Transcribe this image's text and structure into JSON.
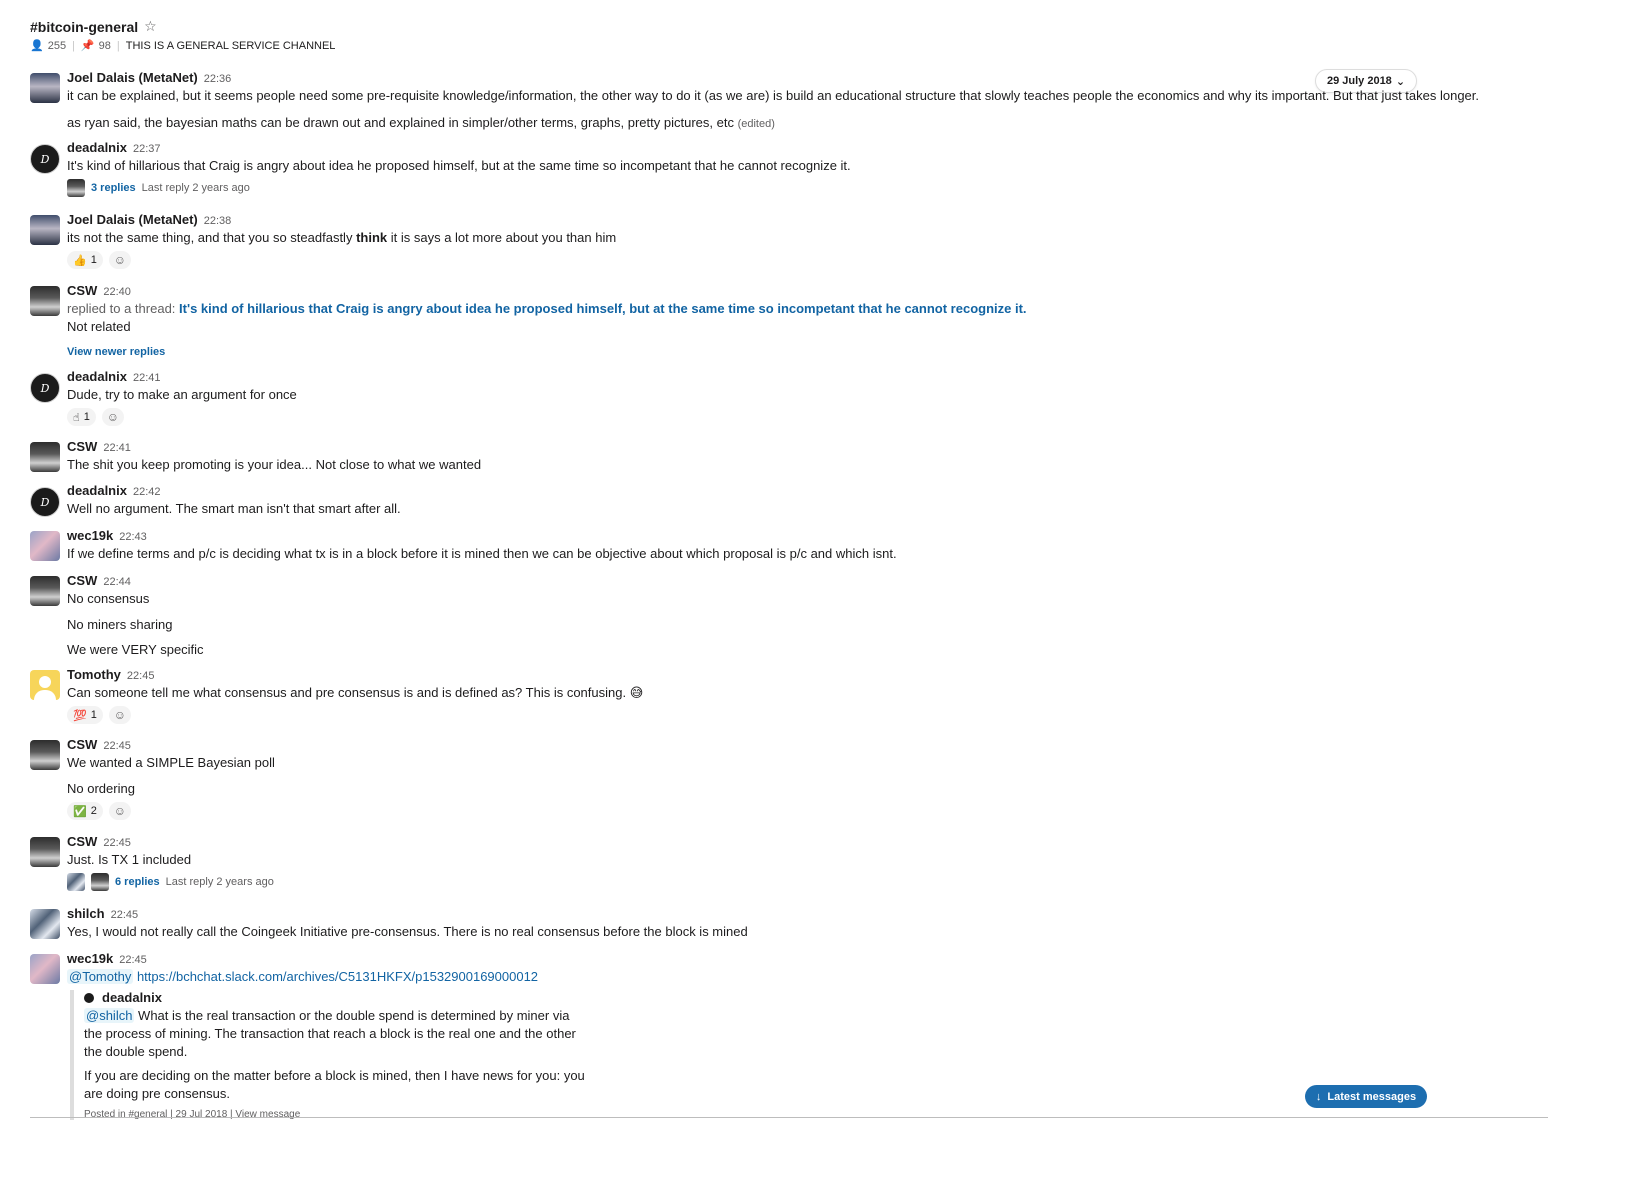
{
  "channel": {
    "name": "#bitcoin-general",
    "members": "255",
    "pins": "98",
    "description": "THIS IS A GENERAL SERVICE CHANNEL"
  },
  "date_pill": "29 July 2018",
  "messages": [
    {
      "name": "Joel Dalais (MetaNet)",
      "time": "22:36",
      "lines": [
        "it can be explained, but it seems people need some pre-requisite knowledge/information, the other way to do it (as we are) is build an educational structure that slowly teaches people the economics and why its important. But that just takes longer.",
        "as ryan said, the bayesian maths can be drawn out and explained in simpler/other terms, graphs, pretty pictures, etc"
      ],
      "edited": "(edited)"
    },
    {
      "name": "deadalnix",
      "time": "22:37",
      "text": "It's kind of hillarious that Craig is angry about idea he proposed himself, but at the same time so incompetant that he cannot recognize it.",
      "thread": {
        "replies": "3 replies",
        "last": "Last reply 2 years ago"
      }
    },
    {
      "name": "Joel Dalais (MetaNet)",
      "time": "22:38",
      "text_a": "its not the same thing, and that you so steadfastly ",
      "text_b": "think",
      "text_c": " it is says a lot more about you than him",
      "reaction": {
        "emoji": "👍",
        "count": "1"
      }
    },
    {
      "name": "CSW",
      "time": "22:40",
      "replied_label": "replied to a thread: ",
      "replied_text": "It's kind of hillarious that Craig is angry about idea he proposed himself, but at the same time so incompetant that he cannot recognize it.",
      "text": "Not related",
      "view_newer": "View newer replies"
    },
    {
      "name": "deadalnix",
      "time": "22:41",
      "text": "Dude, try to make an argument for once",
      "reaction": {
        "emoji": "☝",
        "count": "1"
      }
    },
    {
      "name": "CSW",
      "time": "22:41",
      "text": "The shit you keep promoting is your idea... Not close to what we wanted"
    },
    {
      "name": "deadalnix",
      "time": "22:42",
      "text": "Well no argument. The smart man isn't that smart after all."
    },
    {
      "name": "wec19k",
      "time": "22:43",
      "text": "If we define terms and p/c is deciding what tx is in a block before it is mined then we can be objective about which proposal is p/c and which isnt."
    },
    {
      "name": "CSW",
      "time": "22:44",
      "lines": [
        "No consensus",
        "No miners sharing",
        "We were VERY specific"
      ]
    },
    {
      "name": "Tomothy",
      "time": "22:45",
      "text": "Can someone tell me what consensus and pre consensus is and is defined as? This is confusing. 😅",
      "reaction": {
        "emoji": "💯",
        "count": "1"
      }
    },
    {
      "name": "CSW",
      "time": "22:45",
      "lines": [
        "We wanted a SIMPLE Bayesian poll",
        "No ordering"
      ],
      "reaction": {
        "emoji": "✅",
        "count": "2"
      }
    },
    {
      "name": "CSW",
      "time": "22:45",
      "text": "Just. Is TX 1 included",
      "thread": {
        "replies": "6 replies",
        "last": "Last reply 2 years ago"
      }
    },
    {
      "name": "shilch",
      "time": "22:45",
      "text": "Yes, I would not really call the Coingeek Initiative pre-consensus. There is no real consensus before the block is mined"
    },
    {
      "name": "wec19k",
      "time": "22:45",
      "mention": "@Tomothy",
      "link": "https://bchchat.slack.com/archives/C5131HKFX/p1532900169000012",
      "quote": {
        "name": "deadalnix",
        "mention": "@shilch",
        "line1": " What is the real transaction or the double spend is determined by miner via",
        "line2": "the process of mining. The transaction that reach a block is the real one and the other",
        "line3": "the double spend.",
        "line4": "If you are deciding on the matter before a block is mined, then I have news for you: you",
        "line5": "are doing pre consensus.",
        "footer": "Posted in #general | 29 Jul 2018 | View message"
      }
    }
  ],
  "latest_button": "Latest messages"
}
